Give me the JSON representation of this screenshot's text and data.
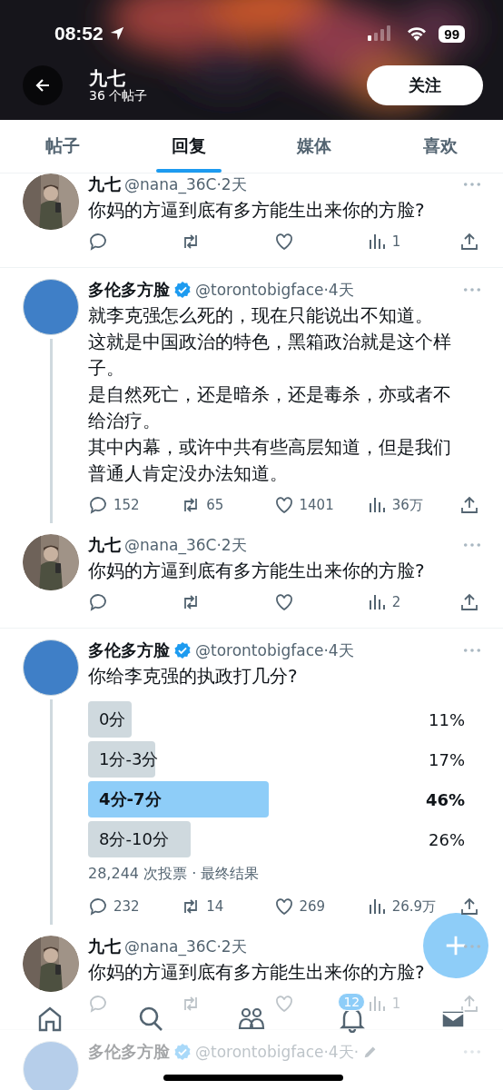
{
  "status_bar": {
    "time": "08:52",
    "battery": "99"
  },
  "header": {
    "title": "九七",
    "subtitle": "36 个帖子",
    "follow_button": "关注"
  },
  "tabs": [
    {
      "label": "帖子",
      "selected": false
    },
    {
      "label": "回复",
      "selected": true
    },
    {
      "label": "媒体",
      "selected": false
    },
    {
      "label": "喜欢",
      "selected": false
    }
  ],
  "posts": [
    {
      "name": "九七",
      "verified": false,
      "meta": "@nana_36C·2天",
      "paragraphs": [
        "你妈的方逼到底有多方能生出来你的方脸?"
      ],
      "stats": {
        "views": "1"
      },
      "thread_line": false
    },
    {
      "kind": "plain",
      "name": "多伦多方脸",
      "verified": true,
      "meta": "@torontobigface·4天",
      "paragraphs": [
        "就李克强怎么死的，现在只能说出不知道。",
        "这就是中国政治的特色，黑箱政治就是这个样子。",
        "是自然死亡，还是暗杀，还是毒杀，亦或者不给治疗。",
        "其中内幕，或许中共有些高层知道，但是我们普通人肯定没办法知道。"
      ],
      "stats": {
        "replies": "152",
        "reposts": "65",
        "likes": "1401",
        "views": "36万"
      },
      "thread_line": true
    },
    {
      "name": "九七",
      "verified": false,
      "meta": "@nana_36C·2天",
      "paragraphs": [
        "你妈的方逼到底有多方能生出来你的方脸?"
      ],
      "stats": {
        "views": "2"
      },
      "thread_line": false
    },
    {
      "kind": "plain",
      "name": "多伦多方脸",
      "verified": true,
      "meta": "@torontobigface·4天",
      "paragraphs": [
        "你给李克强的执政打几分?"
      ],
      "poll": {
        "options": [
          {
            "label": "0分",
            "percent": "11%",
            "selected": false
          },
          {
            "label": "1分-3分",
            "percent": "17%",
            "selected": false
          },
          {
            "label": "4分-7分",
            "percent": "46%",
            "selected": true
          },
          {
            "label": "8分-10分",
            "percent": "26%",
            "selected": false
          }
        ],
        "footer": "28,244 次投票 · 最终结果"
      },
      "stats": {
        "replies": "232",
        "reposts": "14",
        "likes": "269",
        "views": "26.9万"
      },
      "thread_line": true
    },
    {
      "name": "九七",
      "verified": false,
      "meta": "@nana_36C·2天",
      "paragraphs": [
        "你妈的方逼到底有多方能生出来你的方脸?"
      ],
      "stats": {
        "views": "1"
      },
      "thread_line": false
    },
    {
      "kind": "plain",
      "name": "多伦多方脸",
      "verified": true,
      "meta": "@torontobigface·4天·",
      "edited": true,
      "thread_line": false
    }
  ],
  "bottom_nav": [
    {
      "kind": "home"
    },
    {
      "kind": "search"
    },
    {
      "kind": "communities"
    },
    {
      "kind": "notifications",
      "badge": "12"
    },
    {
      "kind": "messages"
    }
  ]
}
